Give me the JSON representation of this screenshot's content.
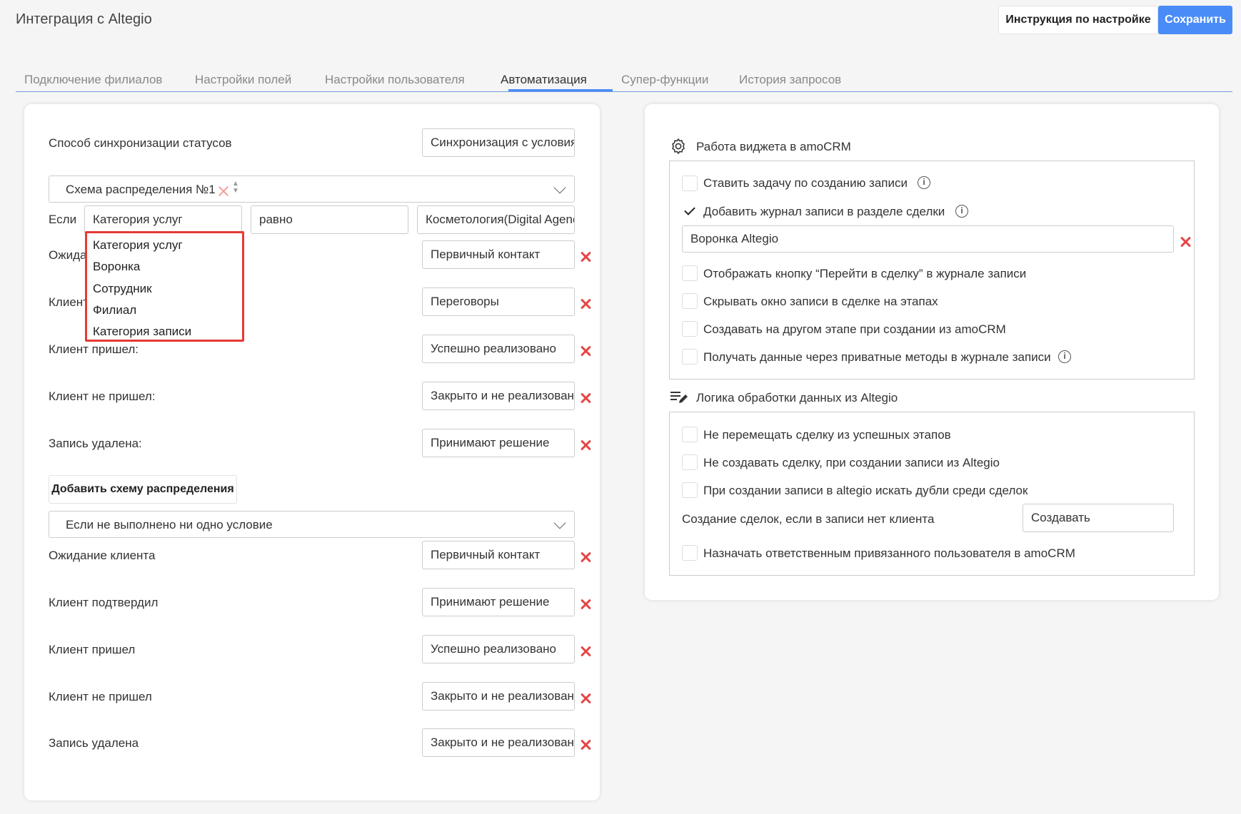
{
  "header": {
    "title": "Интеграция с Altegio",
    "instruction_button": "Инструкция по настройке",
    "save_button": "Сохранить"
  },
  "tabs": [
    {
      "label": "Подключение филиалов"
    },
    {
      "label": "Настройки полей"
    },
    {
      "label": "Настройки пользователя"
    },
    {
      "label": "Автоматизация",
      "active": true
    },
    {
      "label": "Супер-функции"
    },
    {
      "label": "История запросов"
    }
  ],
  "left": {
    "sync_label": "Способ синхронизации статусов",
    "sync_value": "Синхронизация с условиями",
    "scheme_select": "Схема распределения №1",
    "if_label": "Если",
    "condition_field": "Категория услуг",
    "condition_op": "равно",
    "condition_value": "Косметология(Digital Agency)",
    "dropdown_options": [
      "Категория услуг",
      "Воронка",
      "Сотрудник",
      "Филиал",
      "Категория записи"
    ],
    "scheme_rows": [
      {
        "label": "Ожидание клиента:",
        "value": "Первичный контакт"
      },
      {
        "label": "Клиент подтвердил:",
        "value": "Переговоры"
      },
      {
        "label": "Клиент пришел:",
        "value": "Успешно реализовано"
      },
      {
        "label": "Клиент не пришел:",
        "value": "Закрыто и не реализовано"
      },
      {
        "label": "Запись удалена:",
        "value": "Принимают решение"
      }
    ],
    "add_scheme_button": "Добавить схему распределения",
    "fallback_select": "Если не выполнено ни одно условие",
    "fallback_rows": [
      {
        "label": "Ожидание клиента",
        "value": "Первичный контакт"
      },
      {
        "label": "Клиент подтвердил",
        "value": "Принимают решение"
      },
      {
        "label": "Клиент пришел",
        "value": "Успешно реализовано"
      },
      {
        "label": "Клиент не пришел",
        "value": "Закрыто и не реализовано"
      },
      {
        "label": "Запись удалена",
        "value": "Закрыто и не реализовано"
      }
    ]
  },
  "right": {
    "widget_section": {
      "title": "Работа виджета в amoCRM",
      "task_checkbox": "Ставить задачу по созданию записи",
      "journal_checkbox": "Добавить журнал записи в разделе сделки",
      "pipeline_value": "Воронка Altegio",
      "go_to_deal_checkbox": "Отображать кнопку “Перейти в сделку” в журнале записи",
      "hide_window_checkbox": "Скрывать окно записи в сделке на этапах",
      "other_stage_checkbox": "Создавать на другом этапе при создании из amoCRM",
      "private_methods_checkbox": "Получать данные через приватные методы в журнале записи"
    },
    "logic_section": {
      "title": "Логика обработки данных из Altegio",
      "no_move_checkbox": "Не перемещать сделку из успешных этапов",
      "no_create_checkbox": "Не создавать сделку, при создании записи из Altegio",
      "duplicates_checkbox": "При создании записи в altegio искать дубли среди сделок",
      "no_client_label": "Создание сделок, если в записи нет клиента",
      "no_client_value": "Создавать",
      "assign_checkbox": "Назначать ответственным привязанного пользователя в amoCRM"
    }
  },
  "colors": {
    "accent": "#4a8cf7",
    "danger": "#e64545",
    "highlight": "#e53935"
  }
}
